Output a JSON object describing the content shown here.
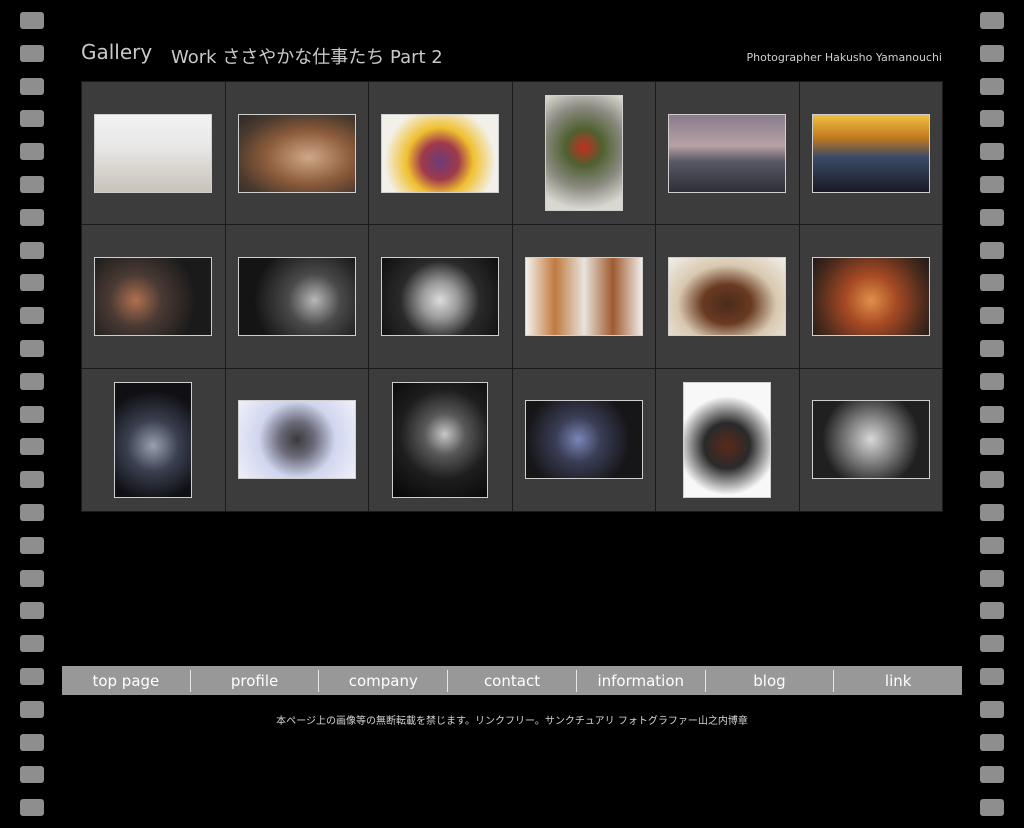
{
  "header": {
    "title": "Gallery",
    "subtitle": "Work ささやかな仕事たち Part 2",
    "credit": "Photographer Hakusho Yamanouchi"
  },
  "gallery": {
    "thumbnails": [
      {
        "name": "thumb-food-spoons",
        "w": 118,
        "h": 79,
        "bg": "linear-gradient(180deg,#f2f2f2 0%,#e8e8e8 40%,#c8c2b8 100%)"
      },
      {
        "name": "thumb-food-pan",
        "w": 118,
        "h": 79,
        "bg": "radial-gradient(ellipse at 60% 55%,#cfa888 0%,#8a5a3a 45%,#4b3a2e 75%,#2e2a28 100%)"
      },
      {
        "name": "thumb-dessert",
        "w": 118,
        "h": 79,
        "bg": "radial-gradient(circle at 50% 60%,#6a3a7a 0%,#a03a4a 25%,#f0c030 45%,#f3f0ea 75%)"
      },
      {
        "name": "thumb-appetizer-plate",
        "w": 78,
        "h": 116,
        "bg": "radial-gradient(circle at 50% 45%,#c03020 0%,#506030 25%,#8a8a80 55%,#d8d8d0 85%)"
      },
      {
        "name": "thumb-car-white-bridge",
        "w": 118,
        "h": 79,
        "bg": "linear-gradient(180deg,#8a7c8e 0%,#b8a0a6 40%,#5a5a66 60%,#2e2e36 100%)"
      },
      {
        "name": "thumb-car-silver-sunset",
        "w": 118,
        "h": 79,
        "bg": "linear-gradient(180deg,#f0c040 0%,#c07820 30%,#3a4a66 55%,#1a1a26 100%)"
      },
      {
        "name": "thumb-watches-pair",
        "w": 118,
        "h": 79,
        "bg": "radial-gradient(circle at 35% 55%,#b07050 0%,#4a3a34 30%,#1a1a1a 70%)"
      },
      {
        "name": "thumb-watches-chrono",
        "w": 118,
        "h": 79,
        "bg": "radial-gradient(circle at 65% 55%,#b8b8b8 0%,#4a4a4a 30%,#141414 70%)"
      },
      {
        "name": "thumb-watch-silver",
        "w": 118,
        "h": 79,
        "bg": "radial-gradient(circle at 50% 55%,#dcdcdc 0%,#9a9a9a 25%,#2a2a2a 55%,#0e0e0e 100%)"
      },
      {
        "name": "thumb-food-squares",
        "w": 118,
        "h": 79,
        "bg": "linear-gradient(90deg,#f4f0ea 0%,#c07a40 25%,#e8e4dc 50%,#a05a30 75%,#f0ece6 100%)"
      },
      {
        "name": "thumb-food-steak",
        "w": 118,
        "h": 79,
        "bg": "radial-gradient(ellipse at 50% 60%,#4a2a1a 0%,#6a3a22 30%,#d8c8b0 60%,#f2eee8 100%)"
      },
      {
        "name": "thumb-food-stirfry",
        "w": 118,
        "h": 79,
        "bg": "radial-gradient(circle at 50% 55%,#e0904a 0%,#a84a24 35%,#4a2a1c 75%,#1e1a18 100%)"
      },
      {
        "name": "thumb-watch-square",
        "w": 78,
        "h": 116,
        "bg": "radial-gradient(circle at 50% 55%,#9aa0b0 0%,#3a4050 35%,#101014 75%)"
      },
      {
        "name": "thumb-watch-chrono-white",
        "w": 118,
        "h": 79,
        "bg": "radial-gradient(circle at 50% 50%,#3a3a3a 0%,#6a6a7a 25%,#d0d6ee 55%,#eef0fa 100%)"
      },
      {
        "name": "thumb-silver-rings",
        "w": 96,
        "h": 116,
        "bg": "radial-gradient(circle at 55% 45%,#c8c8c8 0%,#5a5a5a 25%,#1e1e1e 55%,#050505 100%)"
      },
      {
        "name": "thumb-watches-blue",
        "w": 118,
        "h": 79,
        "bg": "radial-gradient(circle at 45% 50%,#7a86b8 0%,#3a3e56 30%,#161618 70%)"
      },
      {
        "name": "thumb-watches-leather",
        "w": 88,
        "h": 116,
        "bg": "radial-gradient(circle at 50% 55%,#5a2a1a 0%,#2a2a2a 30%,#f8f8f8 65%)"
      },
      {
        "name": "thumb-watches-steel",
        "w": 118,
        "h": 79,
        "bg": "radial-gradient(circle at 50% 50%,#d8d8d8 0%,#8a8a8a 30%,#202020 70%)"
      }
    ]
  },
  "nav": {
    "items": [
      "top page",
      "profile",
      "company",
      "contact",
      "information",
      "blog",
      "link"
    ]
  },
  "footer": {
    "text": "本ページ上の画像等の無断転載を禁じます。リンクフリー。サンクチュアリ フォトグラファー山之内博章"
  }
}
